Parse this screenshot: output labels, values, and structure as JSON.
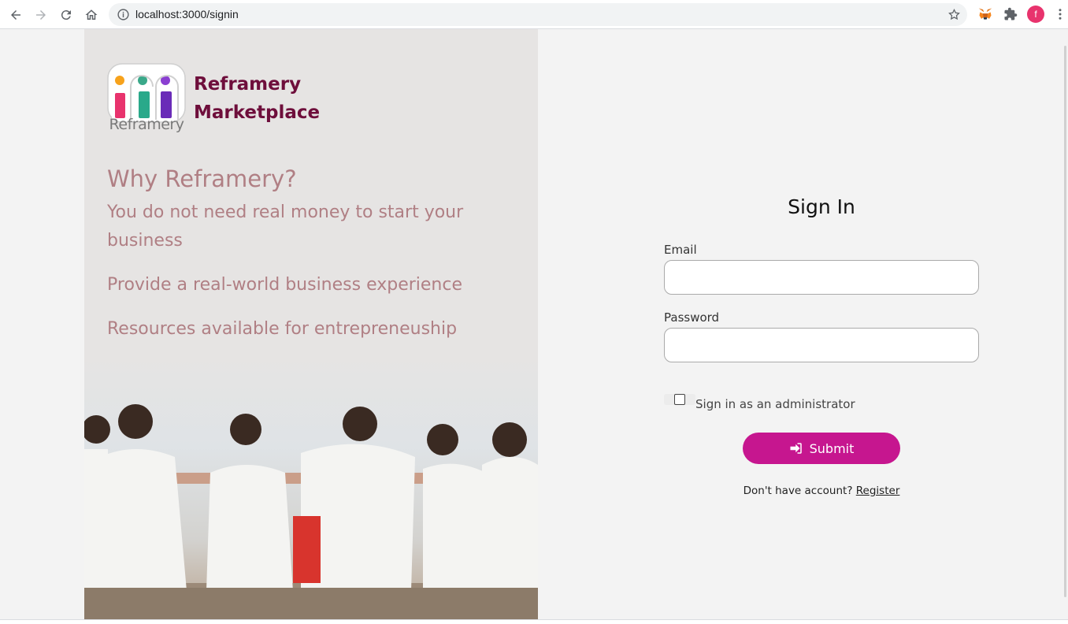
{
  "browser": {
    "url": "localhost:3000/signin",
    "profile_initial": "f",
    "profile_color": "#e8336d"
  },
  "brand": {
    "logo_text": "Reframery",
    "name_line1": "Reframery",
    "name_line2": "Marketplace",
    "color": "#6e0e3b"
  },
  "why": {
    "heading": "Why Reframery?",
    "reasons": [
      "You do not need real money to start your business",
      "Provide a real-world business experience",
      "Resources available for entrepreneuship"
    ]
  },
  "form": {
    "title": "Sign In",
    "email_label": "Email",
    "email_value": "",
    "password_label": "Password",
    "password_value": "",
    "admin_label": "Sign in as an administrator",
    "admin_checked": false,
    "submit_label": "Submit",
    "submit_color": "#c6168f",
    "register_prompt": "Don't have account?",
    "register_link": " Register"
  }
}
